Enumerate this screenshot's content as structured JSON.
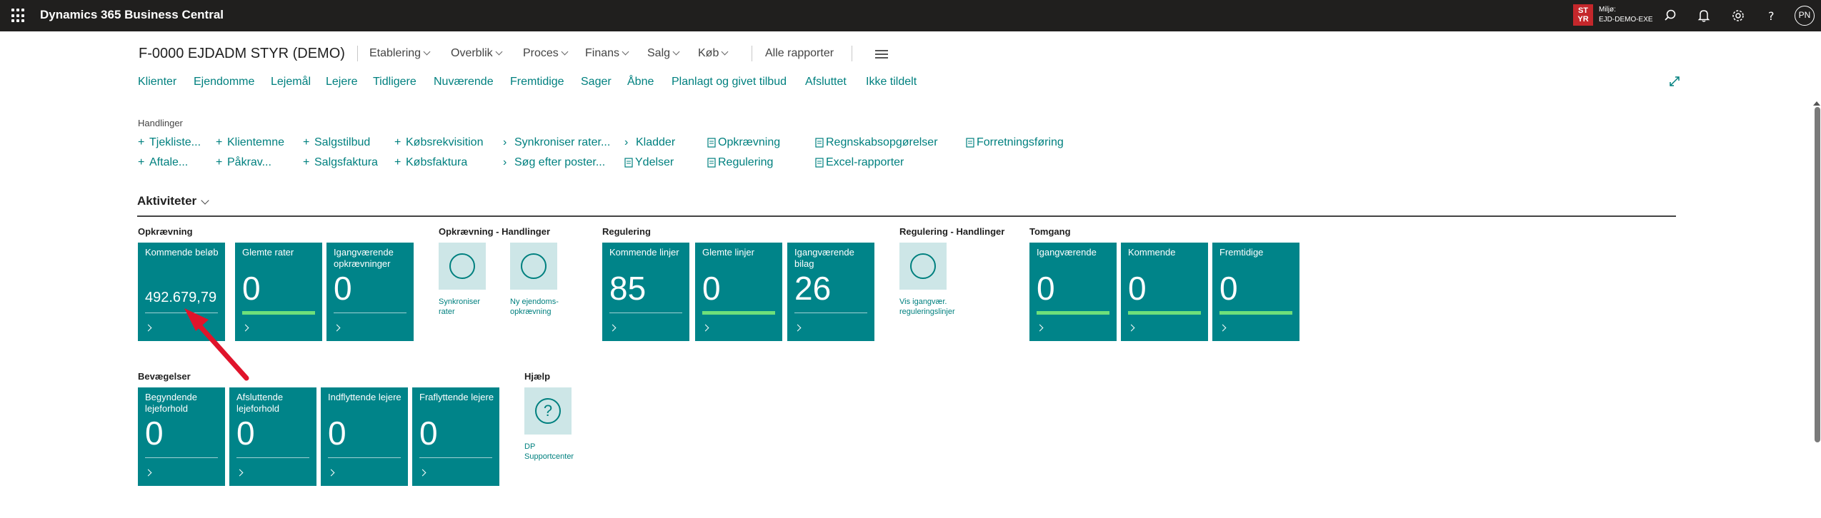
{
  "topbar": {
    "app_title": "Dynamics 365 Business Central",
    "env_badge_line1": "ST",
    "env_badge_line2": "YR",
    "env_label": "Miljø:",
    "env_name": "EJD-DEMO-EXE",
    "avatar_initials": "PN"
  },
  "header": {
    "company": "F-0000 EJDADM STYR (DEMO)",
    "menus": [
      "Etablering",
      "Overblik",
      "Proces",
      "Finans",
      "Salg",
      "Køb"
    ],
    "all_reports": "Alle rapporter"
  },
  "nav": [
    "Klienter",
    "Ejendomme",
    "Lejemål",
    "Lejere",
    "Tidligere",
    "Nuværende",
    "Fremtidige",
    "Sager",
    "Åbne",
    "Planlagt og givet tilbud",
    "Afsluttet",
    "Ikke tildelt"
  ],
  "actions": {
    "label": "Handlinger",
    "items": [
      "Tjekliste...",
      "Aftale...",
      "Klientemne",
      "Påkrav...",
      "Salgstilbud",
      "Salgsfaktura",
      "Købsrekvisition",
      "Købsfaktura",
      "Synkroniser rater...",
      "Søg efter poster...",
      "Kladder",
      "Ydelser",
      "Opkrævning",
      "Regulering",
      "Regnskabsopgørelser",
      "Excel-rapporter",
      "Forretningsføring"
    ]
  },
  "activities": {
    "title": "Aktiviteter",
    "groups": {
      "opkraevning": "Opkrævning",
      "opkraevning_handlinger": "Opkrævning - Handlinger",
      "regulering": "Regulering",
      "regulering_handlinger": "Regulering - Handlinger",
      "tomgang": "Tomgang",
      "bevaegelser": "Bevægelser",
      "hjaelp": "Hjælp"
    },
    "tiles": {
      "kommende_beloeb": {
        "label": "Kommende beløb",
        "value": "492.679,79"
      },
      "glemte_rater": {
        "label": "Glemte rater",
        "value": "0"
      },
      "igangvaerende_opkraevninger": {
        "label": "Igangværende opkrævninger",
        "value": "0"
      },
      "kommende_linjer": {
        "label": "Kommende linjer",
        "value": "85"
      },
      "glemte_linjer": {
        "label": "Glemte linjer",
        "value": "0"
      },
      "igangvaerende_bilag": {
        "label": "Igangværende bilag",
        "value": "26"
      },
      "tomgang_igangvaerende": {
        "label": "Igangværende",
        "value": "0"
      },
      "tomgang_kommende": {
        "label": "Kommende",
        "value": "0"
      },
      "tomgang_fremtidige": {
        "label": "Fremtidige",
        "value": "0"
      },
      "begyndende": {
        "label": "Begyndende lejeforhold",
        "value": "0"
      },
      "afsluttende": {
        "label": "Afsluttende lejeforhold",
        "value": "0"
      },
      "indflyttende": {
        "label": "Indflyttende lejere",
        "value": "0"
      },
      "fraflyttende": {
        "label": "Fraflyttende lejere",
        "value": "0"
      }
    },
    "action_tiles": {
      "synkroniser_line1": "Synkroniser",
      "synkroniser_line2": "rater",
      "ny_line1": "Ny ejendoms-",
      "ny_line2": "opkrævning",
      "vis_line1": "Vis igangvær.",
      "vis_line2": "reguleringslinjer",
      "dp_line1": "DP",
      "dp_line2": "Supportcenter"
    }
  },
  "colors": {
    "tile": "#008489",
    "link": "#00807f",
    "progress": "#6ee07a",
    "annotation_arrow": "#e0142b"
  }
}
